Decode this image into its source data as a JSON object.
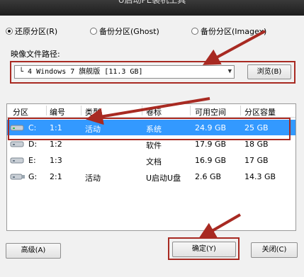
{
  "window": {
    "title": "U启动PE装机工具"
  },
  "modes": [
    {
      "label": "还原分区(R)",
      "selected": true
    },
    {
      "label": "备份分区(Ghost)",
      "selected": false
    },
    {
      "label": "备份分区(Imagex)",
      "selected": false
    }
  ],
  "image_path": {
    "label": "映像文件路径:",
    "value": "└ 4 Windows 7 旗舰版 [11.3 GB]",
    "browse_label": "浏览(B)"
  },
  "table": {
    "headers": [
      "分区",
      "编号",
      "类型",
      "卷标",
      "可用空间",
      "分区容量"
    ],
    "rows": [
      {
        "drive": "C:",
        "num": "1:1",
        "type": "活动",
        "label": "系统",
        "free": "24.9 GB",
        "size": "25 GB",
        "selected": true,
        "icon": "system-drive-icon"
      },
      {
        "drive": "D:",
        "num": "1:2",
        "type": "",
        "label": "软件",
        "free": "17.9 GB",
        "size": "18 GB",
        "selected": false,
        "icon": "hard-drive-icon"
      },
      {
        "drive": "E:",
        "num": "1:3",
        "type": "",
        "label": "文档",
        "free": "16.9 GB",
        "size": "17 GB",
        "selected": false,
        "icon": "hard-drive-icon"
      },
      {
        "drive": "G:",
        "num": "2:1",
        "type": "活动",
        "label": "U启动U盘",
        "free": "2.6 GB",
        "size": "14.3 GB",
        "selected": false,
        "icon": "usb-drive-icon"
      }
    ]
  },
  "buttons": {
    "advanced": "高级(A)",
    "ok": "确定(Y)",
    "close": "关闭(C)"
  },
  "colors": {
    "highlight": "#3399ff",
    "annotation": "#a82a22"
  }
}
